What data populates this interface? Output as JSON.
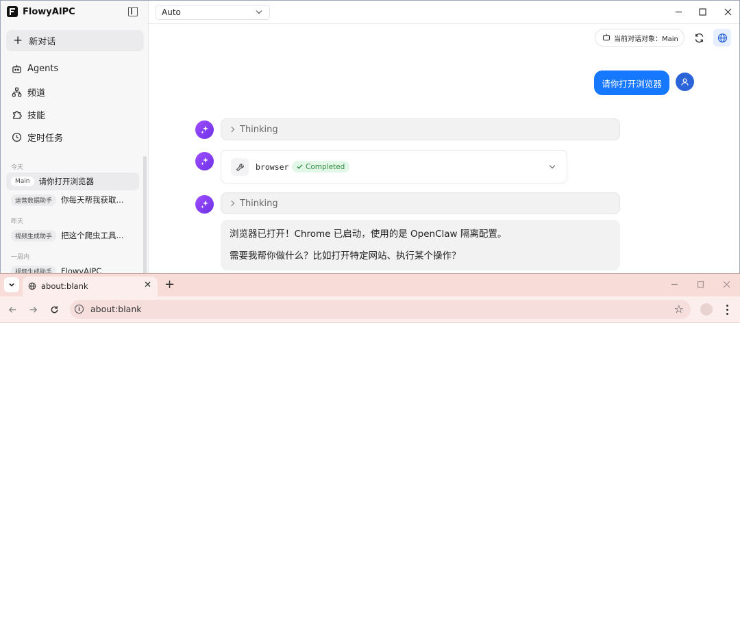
{
  "app": {
    "name": "FlowyAIPC",
    "new_chat_label": "新对话",
    "nav": [
      {
        "label": "Agents",
        "icon": "robot-icon"
      },
      {
        "label": "频道",
        "icon": "network-icon"
      },
      {
        "label": "技能",
        "icon": "puzzle-icon"
      },
      {
        "label": "定时任务",
        "icon": "clock-icon"
      }
    ],
    "sections": [
      {
        "title": "今天",
        "items": [
          {
            "tag": "Main",
            "title": "请你打开浏览器",
            "active": true
          },
          {
            "tag": "运营数据助手",
            "title": "你每天帮我获取..."
          }
        ]
      },
      {
        "title": "昨天",
        "items": [
          {
            "tag": "视频生成助手",
            "title": "把这个爬虫工具..."
          }
        ]
      },
      {
        "title": "一周内",
        "items": [
          {
            "tag": "视频生成助手",
            "title": "FlowyAIPC"
          }
        ]
      }
    ],
    "model_select": {
      "value": "Auto"
    },
    "target_label": "当前对话对象：Main",
    "chat": {
      "user_message": "请你打开浏览器",
      "thinking_label": "Thinking",
      "tool": {
        "name": "browser",
        "status": "Completed"
      },
      "answer_lines": [
        "浏览器已打开！Chrome 已启动，使用的是 OpenClaw 隔离配置。",
        "需要我帮你做什么？比如打开特定网站、执行某个操作？"
      ]
    },
    "colors": {
      "accent": "#1677ff",
      "bot_avatar": "#8a3ffc",
      "status_green": "#2e8b3e"
    }
  },
  "chrome": {
    "tab_title": "about:blank",
    "address": "about:blank",
    "tab_close": "✕",
    "new_tab": "+"
  }
}
